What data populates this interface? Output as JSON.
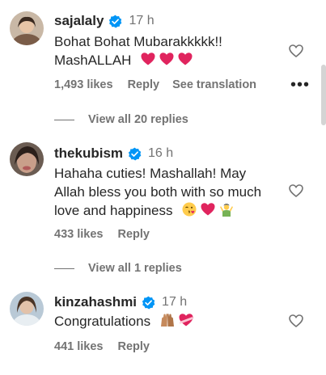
{
  "comments": [
    {
      "username": "sajalaly",
      "time": "17 h",
      "verified": true,
      "text_line1": "Bohat Bohat Mubarakkkkk!!",
      "text_line2": "MashALLAH",
      "likes": "1,493 likes",
      "reply": "Reply",
      "translate": "See translation",
      "more": "•••",
      "view_replies": "View all 20 replies"
    },
    {
      "username": "thekubism",
      "time": "16 h",
      "verified": true,
      "text_line1": "Hahaha cuties! Mashallah! May",
      "text_line2": "Allah bless you both with so much",
      "text_line3": "love and happiness",
      "likes": "433 likes",
      "reply": "Reply",
      "view_replies": "View all 1 replies"
    },
    {
      "username": "kinzahashmi",
      "time": "17 h",
      "verified": true,
      "text_line1": "Congratulations",
      "likes": "441 likes",
      "reply": "Reply"
    }
  ],
  "colors": {
    "verified_badge": "#0095f6",
    "secondary_text": "#737373",
    "heart_emoji": "#e0245e"
  }
}
